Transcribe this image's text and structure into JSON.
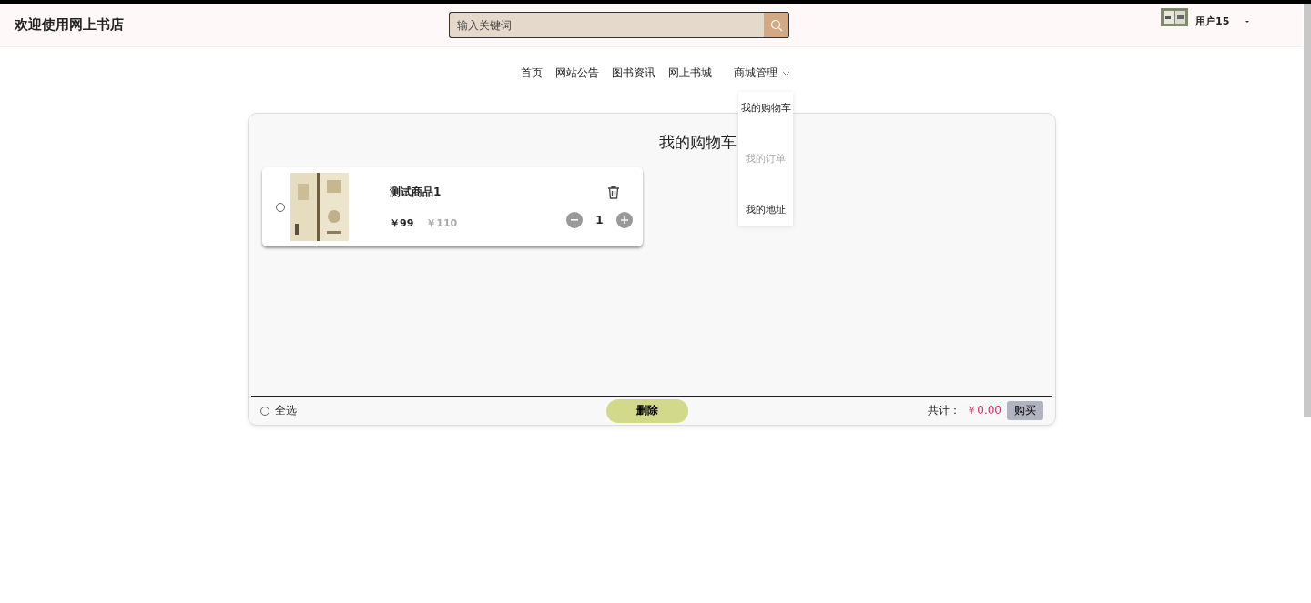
{
  "header": {
    "title": "欢迎使用网上书店",
    "search": {
      "placeholder": "输入关键词"
    },
    "user": {
      "name": "用户15"
    }
  },
  "nav": [
    {
      "label": "首页",
      "kind": "link"
    },
    {
      "label": "网站公告",
      "kind": "link"
    },
    {
      "label": "图书资讯",
      "kind": "link"
    },
    {
      "label": "网上书城",
      "kind": "link"
    },
    {
      "label": "商城管理",
      "kind": "dropdown",
      "expanded": true,
      "menu": [
        {
          "label": "我的购物车",
          "hovered": false
        },
        {
          "label": "我的订单",
          "hovered": true
        },
        {
          "label": "我的地址",
          "hovered": false
        }
      ]
    }
  ],
  "cart": {
    "title": "我的购物车",
    "items": [
      {
        "name": "测试商品1",
        "price": "￥99",
        "original_price": "￥110",
        "quantity": "1",
        "checked": false
      }
    ],
    "footer": {
      "select_all": {
        "label": "全选",
        "checked": false
      },
      "delete_button": "删除",
      "total_label": "共计：",
      "total": "￥0.00",
      "buy_button": "购买"
    }
  }
}
